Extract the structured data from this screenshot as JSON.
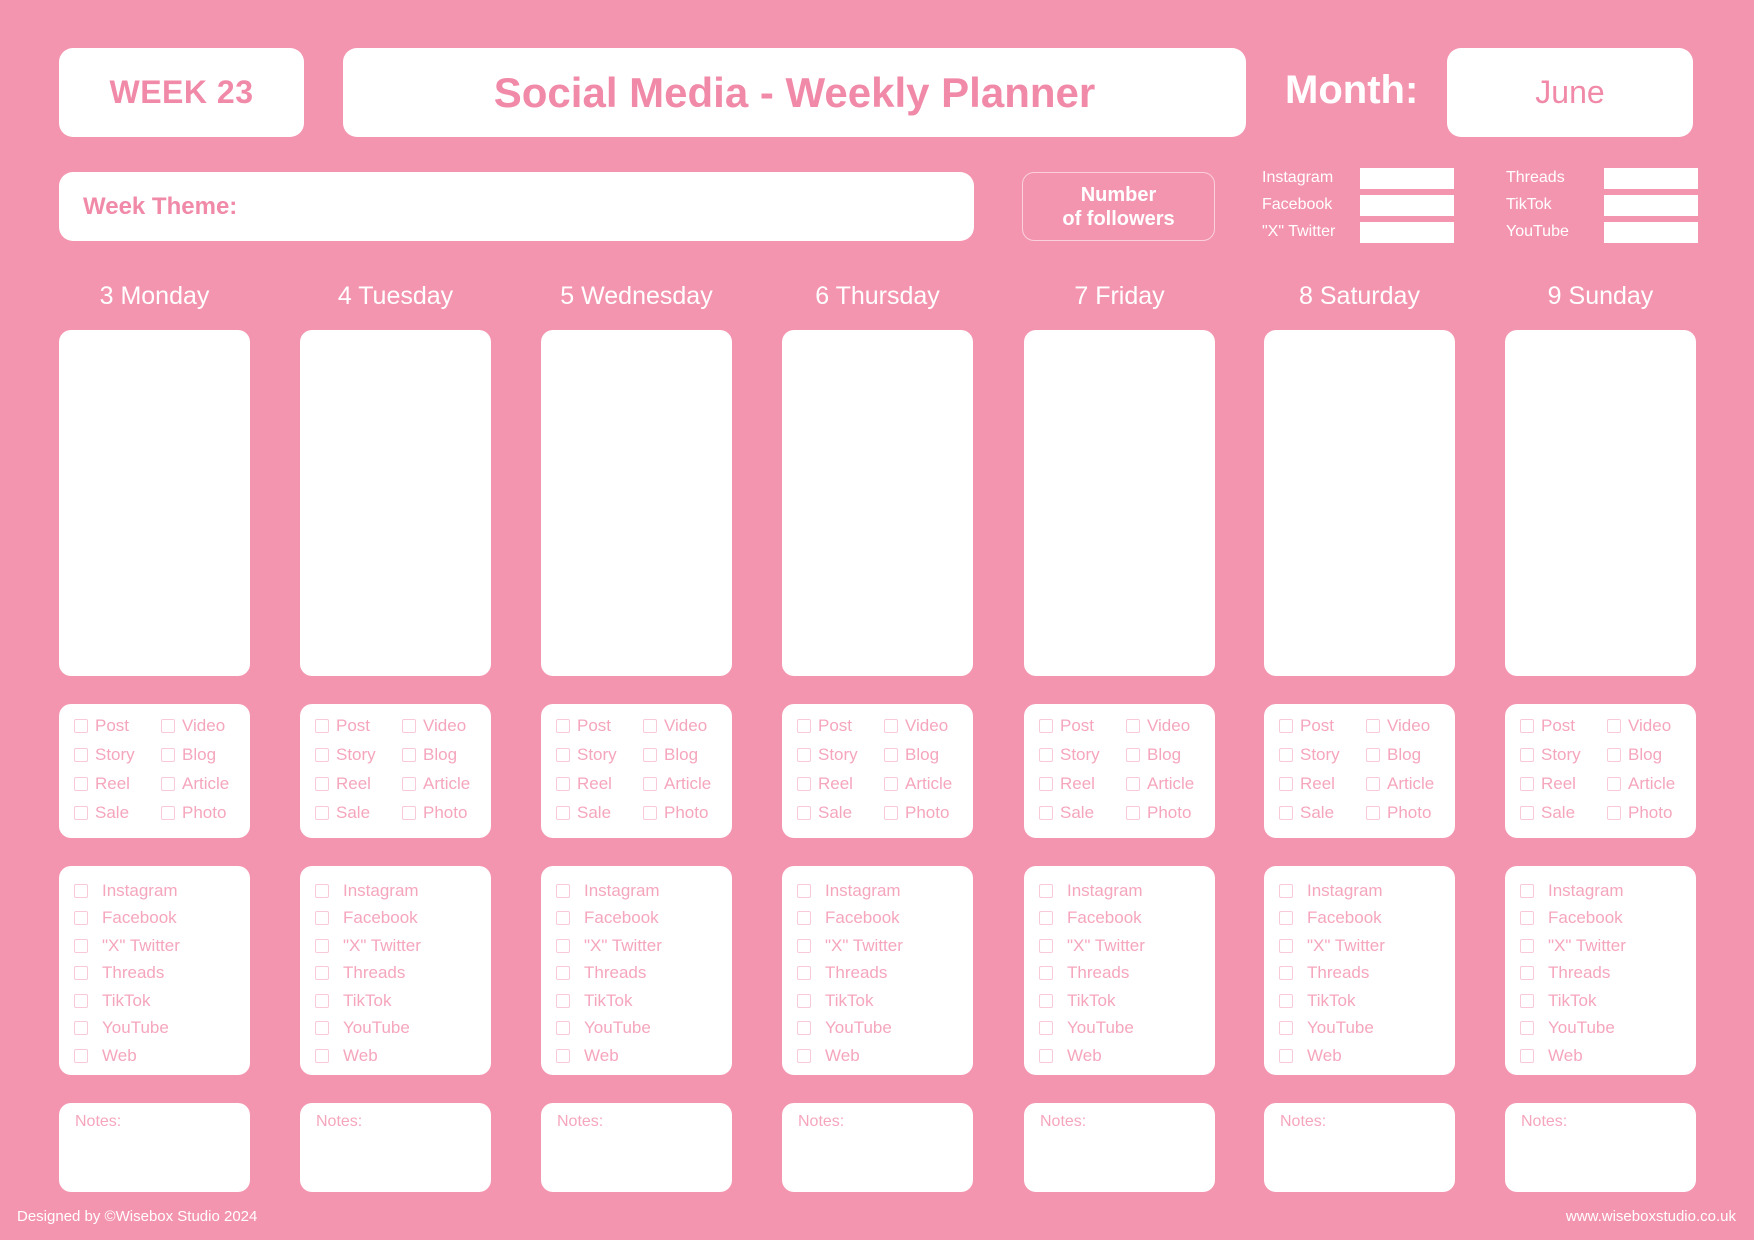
{
  "header": {
    "week": "WEEK 23",
    "title": "Social Media - Weekly Planner",
    "month_label": "Month:",
    "month_value": "June"
  },
  "theme": {
    "label": "Week Theme:"
  },
  "followers": {
    "label_line1": "Number",
    "label_line2": "of followers",
    "left": [
      "Instagram",
      "Facebook",
      "\"X\" Twitter"
    ],
    "right": [
      "Threads",
      "TikTok",
      "YouTube"
    ]
  },
  "days": [
    {
      "label": "3 Monday"
    },
    {
      "label": "4 Tuesday"
    },
    {
      "label": "5 Wednesday"
    },
    {
      "label": "6 Thursday"
    },
    {
      "label": "7 Friday"
    },
    {
      "label": "8 Saturday"
    },
    {
      "label": "9 Sunday"
    }
  ],
  "content_types": [
    "Post",
    "Video",
    "Story",
    "Blog",
    "Reel",
    "Article",
    "Sale",
    "Photo"
  ],
  "platforms": [
    "Instagram",
    "Facebook",
    "\"X\" Twitter",
    "Threads",
    "TikTok",
    "YouTube",
    "Web"
  ],
  "notes_label": "Notes:",
  "footer": {
    "credit": "Designed by ©Wisebox Studio 2024",
    "website": "www.wiseboxstudio.co.uk"
  },
  "colors": {
    "background": "#f495b0",
    "accent": "#f08aa8",
    "panel": "#ffffff"
  }
}
